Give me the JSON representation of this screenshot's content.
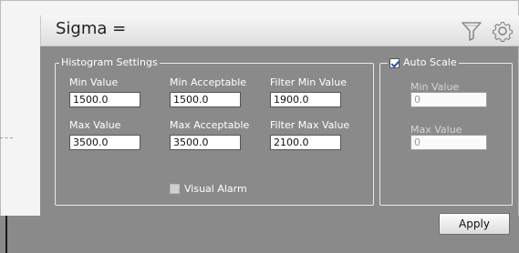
{
  "header": {
    "title": "Sigma =",
    "filter_icon": "filter-icon",
    "gear_icon": "gear-icon"
  },
  "histogram_settings": {
    "legend": "Histogram Settings",
    "min_value": {
      "label": "Min Value",
      "value": "1500.0"
    },
    "min_acceptable": {
      "label": "Min Acceptable",
      "value": "1500.0"
    },
    "filter_min_value": {
      "label": "Filter Min Value",
      "value": "1900.0"
    },
    "max_value": {
      "label": "Max Value",
      "value": "3500.0"
    },
    "max_acceptable": {
      "label": "Max Acceptable",
      "value": "3500.0"
    },
    "filter_max_value": {
      "label": "Filter Max Value",
      "value": "2100.0"
    },
    "visual_alarm": {
      "label": "Visual Alarm",
      "checked": false
    }
  },
  "auto_scale": {
    "label": "Auto Scale",
    "checked": true,
    "min_value": {
      "label": "Min Value",
      "value": "0"
    },
    "max_value": {
      "label": "Max Value",
      "value": "0"
    }
  },
  "apply_label": "Apply",
  "colors": {
    "panel": "#8a8a8a",
    "titlebar": "#e8e8e8",
    "checkbox_accent": "#2b4fa6"
  }
}
